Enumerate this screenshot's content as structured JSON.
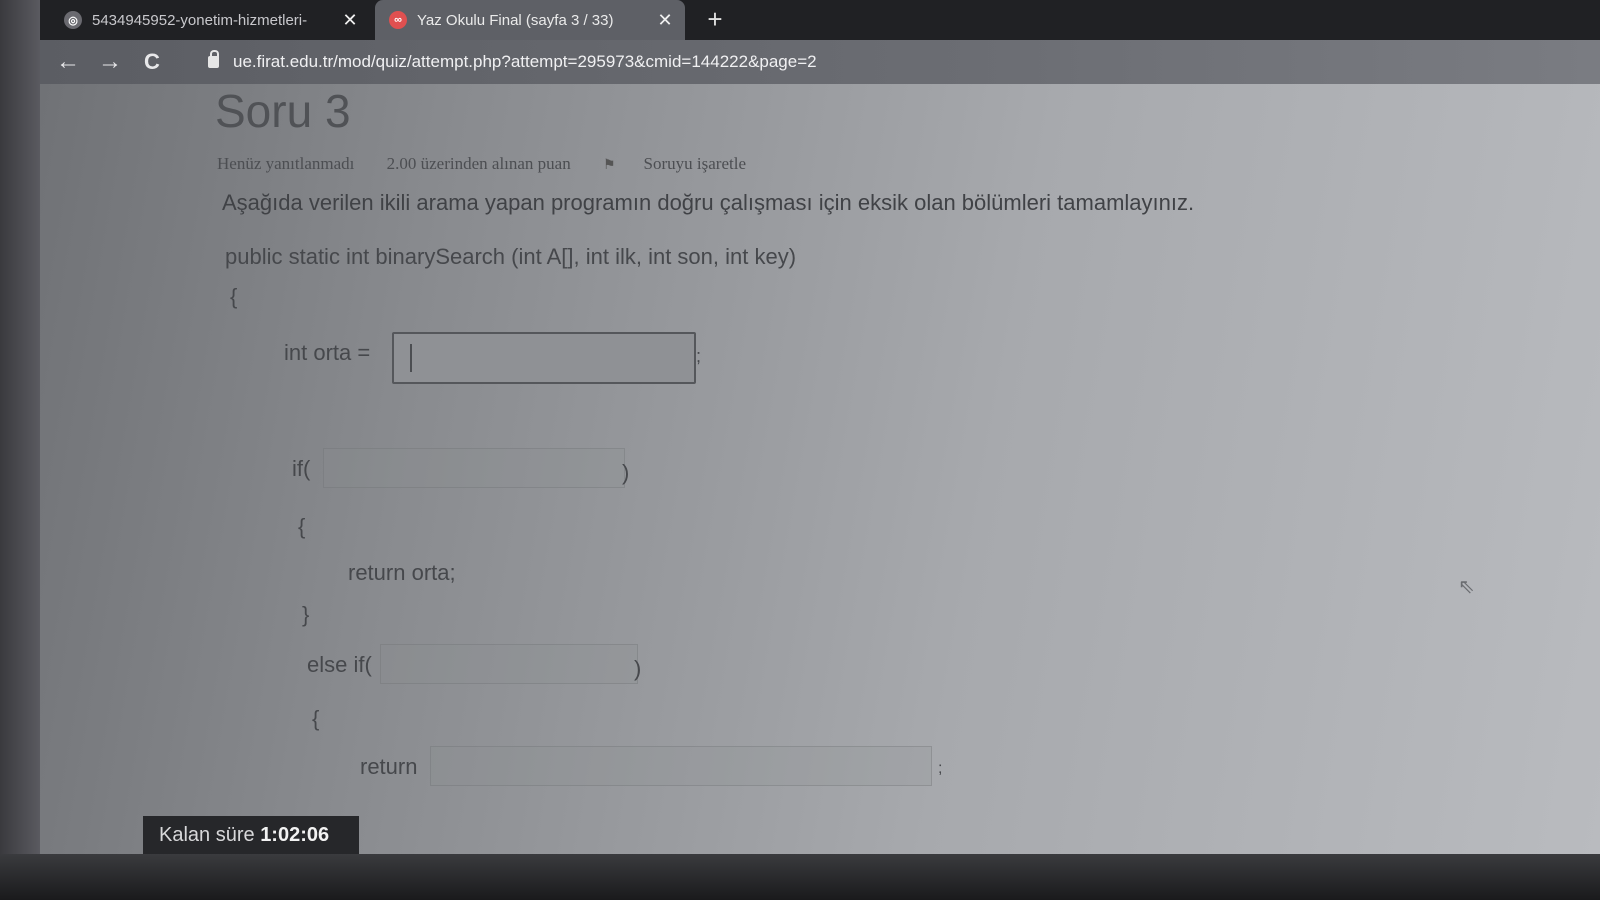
{
  "browser": {
    "tabs": [
      {
        "title": "5434945952-yonetim-hizmetleri-",
        "close": "✕",
        "favicon": "globe-icon"
      },
      {
        "title": "Yaz Okulu Final (sayfa 3 / 33)",
        "close": "✕",
        "favicon": "moodle-icon"
      }
    ],
    "new_tab": "+",
    "nav": {
      "back": "←",
      "forward": "→",
      "reload": "C"
    },
    "url": "ue.firat.edu.tr/mod/quiz/attempt.php?attempt=295973&cmid=144222&page=2"
  },
  "question": {
    "heading": "Soru 3",
    "status": "Henüz yanıtlanmadı",
    "points": "2.00 üzerinden alınan puan",
    "flag": "Soruyu işaretle",
    "text": "Aşağıda verilen ikili arama yapan programın doğru çalışması için eksik olan bölümleri tamamlayınız."
  },
  "code": {
    "signature": "public static int binarySearch (int A[], int ilk, int son, int key)",
    "open_brace": "{",
    "orta_label": "int orta =",
    "orta_value": "",
    "orta_semicolon": ";",
    "if_open": "if(",
    "if_close": ")",
    "brace1_open": "{",
    "return_orta": "return orta;",
    "brace1_close": "}",
    "elseif_open": "else if(",
    "elseif_close": ")",
    "brace2_open": "{",
    "return_kw": "return",
    "return_semicolon": ";"
  },
  "timer": {
    "label": "Kalan süre",
    "value": "1:02:06"
  }
}
